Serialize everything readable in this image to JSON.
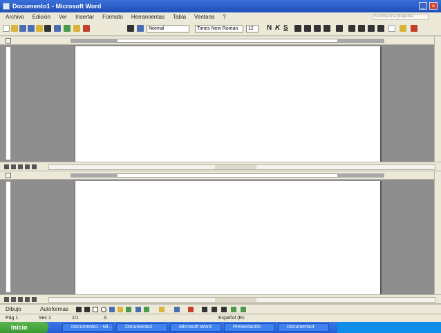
{
  "window": {
    "title": "Documento1 - Microsoft Word"
  },
  "menu": {
    "items": [
      "Archivo",
      "Edición",
      "Ver",
      "Insertar",
      "Formato",
      "Herramientas",
      "Tabla",
      "Ventana",
      "?"
    ],
    "help_placeholder": "Escriba una pregunta"
  },
  "toolbar": {
    "style": "Normal",
    "font": "Times New Roman",
    "size": "12",
    "bold": "N",
    "italic": "K",
    "underline": "S"
  },
  "drawing": {
    "draw_label": "Dibujo",
    "autoshapes_label": "Autoformas"
  },
  "status": {
    "page": "Pág 1",
    "section": "Sec 1",
    "page_of": "1/1",
    "position": "A",
    "language": "Español (Es"
  },
  "taskbar": {
    "start_label": "Inicio",
    "tasks": [
      "Documento1 - Mi...",
      "Documento2",
      "Microsoft Word",
      "Presentación",
      "Documento3"
    ]
  }
}
